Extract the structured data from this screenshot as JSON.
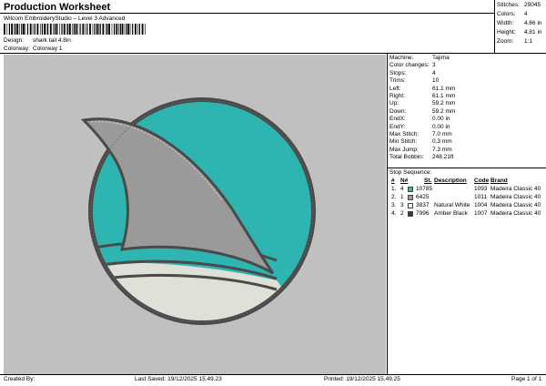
{
  "header": {
    "title": "Production Worksheet",
    "subtitle": "Wilcom EmbroideryStudio – Level 3 Advanced",
    "design_label": "Design:",
    "design_value": "shark tail 4.8in",
    "colorway_label": "Colorway:",
    "colorway_value": "Colorway 1"
  },
  "summary": {
    "stitches_label": "Stitches:",
    "stitches": "29045",
    "colors_label": "Colors:",
    "colors": "4",
    "width_label": "Width:",
    "width": "4.66 in",
    "height_label": "Height:",
    "height": "4.81 in",
    "zoom_label": "Zoom:",
    "zoom": "1:1"
  },
  "params": [
    {
      "label": "Machine:",
      "value": "Tajima"
    },
    {
      "label": "Color changes:",
      "value": "3"
    },
    {
      "label": "Stops:",
      "value": "4"
    },
    {
      "label": "Trims:",
      "value": "10"
    },
    {
      "label": "Left:",
      "value": "61.1 mm"
    },
    {
      "label": "Right:",
      "value": "61.1 mm"
    },
    {
      "label": "Up:",
      "value": "59.2 mm"
    },
    {
      "label": "Down:",
      "value": "59.2 mm"
    },
    {
      "label": "EndX:",
      "value": "0.00 in"
    },
    {
      "label": "EndY:",
      "value": "0.00 in"
    },
    {
      "label": "Max Stitch:",
      "value": "7.0 mm"
    },
    {
      "label": "Min Stitch:",
      "value": "0.3 mm"
    },
    {
      "label": "Max Jump:",
      "value": "7.3 mm"
    },
    {
      "label": "Total Bobbin:",
      "value": "248.21ft"
    }
  ],
  "stop_sequence": {
    "title": "Stop Sequence:",
    "headers": {
      "num": "#",
      "n": "N#",
      "st": "St.",
      "desc": "Description",
      "code": "Code",
      "brand": "Brand"
    },
    "rows": [
      {
        "num": "1.",
        "n": "4",
        "color": "#2fb5b1",
        "st": "10785",
        "desc": "",
        "code": "1093",
        "brand": "Madeira Classic 40"
      },
      {
        "num": "2.",
        "n": "1",
        "color": "#9a9a9a",
        "st": "6425",
        "desc": "",
        "code": "1011",
        "brand": "Madeira Classic 40"
      },
      {
        "num": "3.",
        "n": "3",
        "color": "#f2f2ec",
        "st": "3837",
        "desc": "Natural White",
        "code": "1004",
        "brand": "Madeira Classic 40"
      },
      {
        "num": "4.",
        "n": "2",
        "color": "#3a3a3a",
        "st": "7996",
        "desc": "Amber Black",
        "code": "1007",
        "brand": "Madeira Classic 40"
      }
    ]
  },
  "footer": {
    "created": "Created By:",
    "last_saved": "Last Saved: 19/12/2025 15.49.23",
    "printed": "Printed: 19/12/2025 15.49.25",
    "page": "Page 1 of 1"
  },
  "design_colors": {
    "background": "#c0c0c0",
    "teal": "#2fb5b1",
    "gray_fin": "#9a9a9a",
    "outline": "#4a4a4a",
    "cream": "#e4e6de"
  }
}
